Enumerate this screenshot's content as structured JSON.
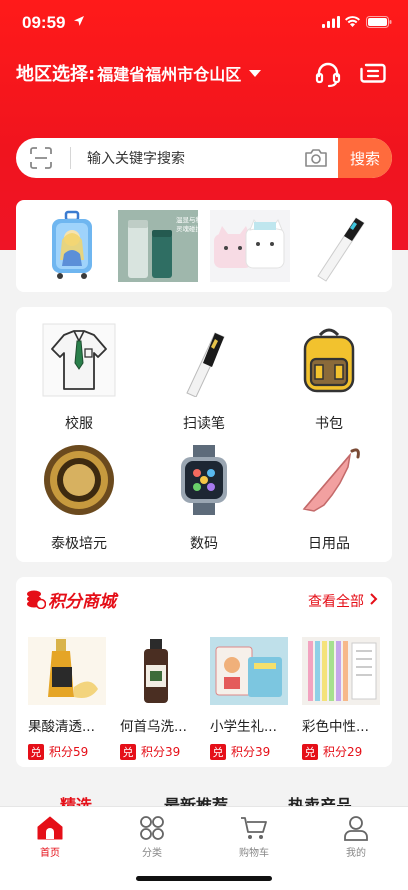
{
  "status_bar": {
    "time": "09:59"
  },
  "header": {
    "region_label": "地区选择:",
    "region_value": "福建省福州市仓山区"
  },
  "search": {
    "placeholder": "输入关键字搜索",
    "button": "搜索"
  },
  "categories": [
    {
      "name": "校服",
      "icon": "uniform-shirt-icon"
    },
    {
      "name": "扫读笔",
      "icon": "scan-pen-icon"
    },
    {
      "name": "书包",
      "icon": "backpack-icon"
    },
    {
      "name": "泰极培元",
      "icon": "taiji-badge-icon"
    },
    {
      "name": "数码",
      "icon": "smartwatch-icon"
    },
    {
      "name": "日用品",
      "icon": "umbrella-icon"
    }
  ],
  "banner_products": [
    {
      "name": "kids-suitcase"
    },
    {
      "name": "smart-thermos",
      "caption_line1": "温显与科技",
      "caption_line2": "灵魂碰撞"
    },
    {
      "name": "mini-printer"
    },
    {
      "name": "scan-pen"
    }
  ],
  "mall": {
    "title": "积分商城",
    "more": "查看全部",
    "items": [
      {
        "name": "果酸清透...",
        "tag": "兑",
        "points": "积分59"
      },
      {
        "name": "何首乌洗...",
        "tag": "兑",
        "points": "积分39"
      },
      {
        "name": "小学生礼...",
        "tag": "兑",
        "points": "积分39"
      },
      {
        "name": "彩色中性...",
        "tag": "兑",
        "points": "积分29"
      }
    ]
  },
  "section_tabs": [
    "精选",
    "最新推荐",
    "热卖产品"
  ],
  "tabbar": [
    {
      "label": "首页",
      "active": true
    },
    {
      "label": "分类",
      "active": false
    },
    {
      "label": "购物车",
      "active": false
    },
    {
      "label": "我的",
      "active": false
    }
  ],
  "colors": {
    "primary": "#e50f18",
    "search_button": "#ff6b3d",
    "hero": "#f0141e"
  }
}
